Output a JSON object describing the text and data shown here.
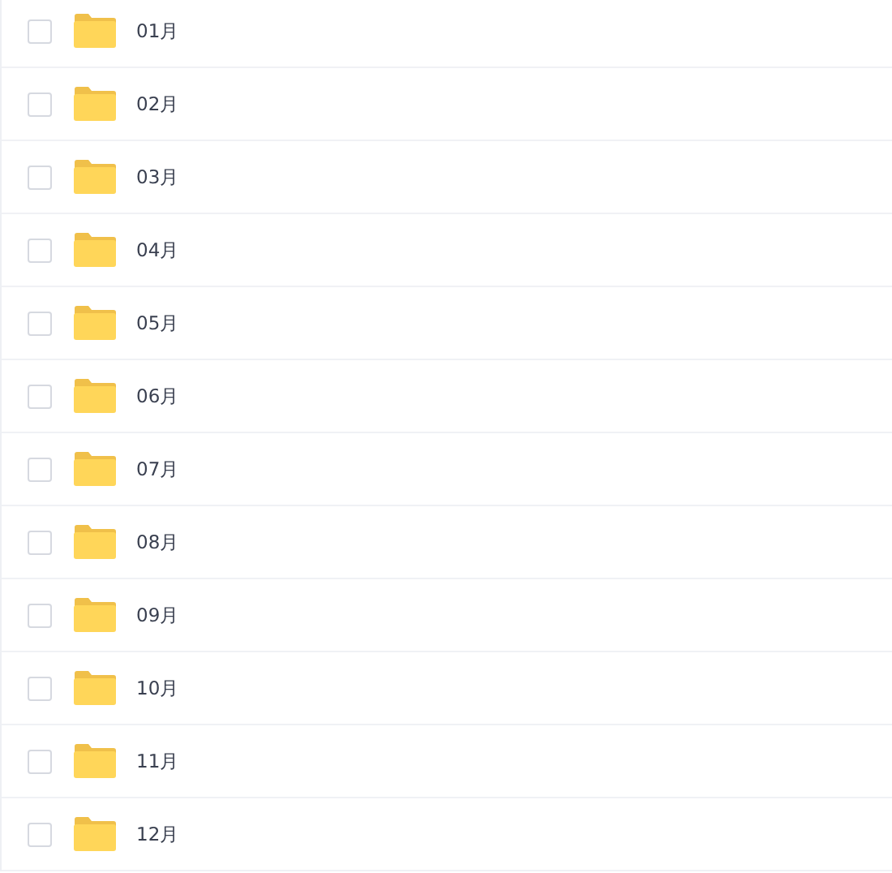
{
  "folders": [
    {
      "name": "01月",
      "checked": false
    },
    {
      "name": "02月",
      "checked": false
    },
    {
      "name": "03月",
      "checked": false
    },
    {
      "name": "04月",
      "checked": false
    },
    {
      "name": "05月",
      "checked": false
    },
    {
      "name": "06月",
      "checked": false
    },
    {
      "name": "07月",
      "checked": false
    },
    {
      "name": "08月",
      "checked": false
    },
    {
      "name": "09月",
      "checked": false
    },
    {
      "name": "10月",
      "checked": false
    },
    {
      "name": "11月",
      "checked": false
    },
    {
      "name": "12月",
      "checked": false
    }
  ]
}
